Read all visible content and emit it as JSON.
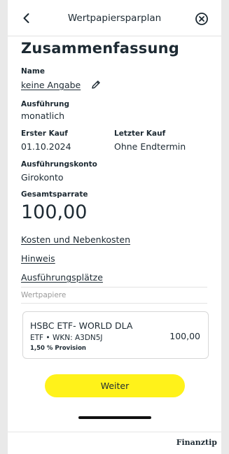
{
  "header": {
    "title": "Wertpapiersparplan",
    "back_icon": "chevron-left-icon",
    "close_icon": "close-circle-icon"
  },
  "page": {
    "heading": "Zusammenfassung"
  },
  "fields": {
    "name": {
      "label": "Name",
      "value": "keine Angabe",
      "edit_icon": "pencil-icon"
    },
    "execution": {
      "label": "Ausführung",
      "value": "monatlich"
    },
    "first_purchase": {
      "label": "Erster Kauf",
      "value": "01.10.2024"
    },
    "last_purchase": {
      "label": "Letzter Kauf",
      "value": "Ohne Endtermin"
    },
    "account": {
      "label": "Ausführungskonto",
      "value": "Girokonto"
    },
    "total_rate": {
      "label": "Gesamtsparrate",
      "value": "100,00"
    }
  },
  "links": {
    "costs": "Kosten und Nebenkosten",
    "notice": "Hinweis",
    "venues": "Ausführungsplätze"
  },
  "securities": {
    "section_label": "Wertpapiere",
    "items": [
      {
        "name": "HSBC ETF- WORLD DLA",
        "details": "ETF • WKN: A3DN5J",
        "commission": "1,50 % Provision",
        "amount": "100,00"
      }
    ]
  },
  "actions": {
    "continue_label": "Weiter"
  },
  "footer": {
    "brand": "Finanztip"
  },
  "colors": {
    "accent": "#fff21a",
    "text": "#1d2a33",
    "muted": "#9a9a9a"
  }
}
